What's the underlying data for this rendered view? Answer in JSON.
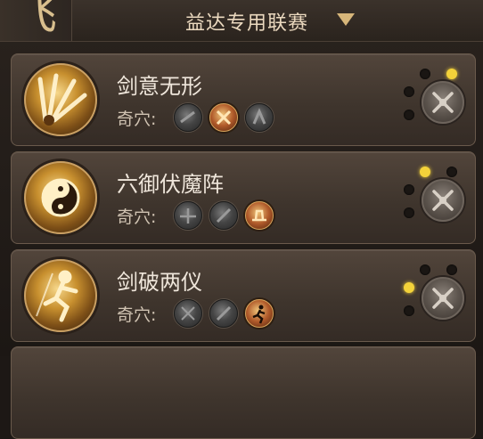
{
  "header": {
    "logo_glyph": "飞",
    "filter": {
      "label": "益达专用联赛",
      "icon": "triangle-down-icon",
      "accent": "#d7b67a"
    }
  },
  "colors": {
    "active_slot": "#f3d23a",
    "title": "#efe6db"
  },
  "talent_label": "奇穴:",
  "cards": [
    {
      "title": "剑意无形",
      "icon": "sword-fan-icon",
      "talents": [
        {
          "icon": "dark-talent-icon",
          "active": false
        },
        {
          "icon": "crossed-blades-talent-icon",
          "active": true
        },
        {
          "icon": "dark-talent-icon",
          "active": false
        }
      ],
      "slots": [
        false,
        true,
        false,
        false
      ],
      "config_icon": "crossed-swords-icon"
    },
    {
      "title": "六御伏魔阵",
      "icon": "taiji-icon",
      "talents": [
        {
          "icon": "dark-talent-icon",
          "active": false
        },
        {
          "icon": "dark-talent-icon",
          "active": false
        },
        {
          "icon": "hat-talent-icon",
          "active": true
        }
      ],
      "slots": [
        true,
        false,
        false,
        false
      ],
      "config_icon": "crossed-swords-icon"
    },
    {
      "title": "剑破两仪",
      "icon": "leaping-figure-icon",
      "talents": [
        {
          "icon": "dark-talent-icon",
          "active": false
        },
        {
          "icon": "dark-talent-icon",
          "active": false
        },
        {
          "icon": "running-figure-talent-icon",
          "active": true
        }
      ],
      "slots": [
        false,
        false,
        true,
        false
      ],
      "config_icon": "crossed-swords-icon"
    }
  ]
}
